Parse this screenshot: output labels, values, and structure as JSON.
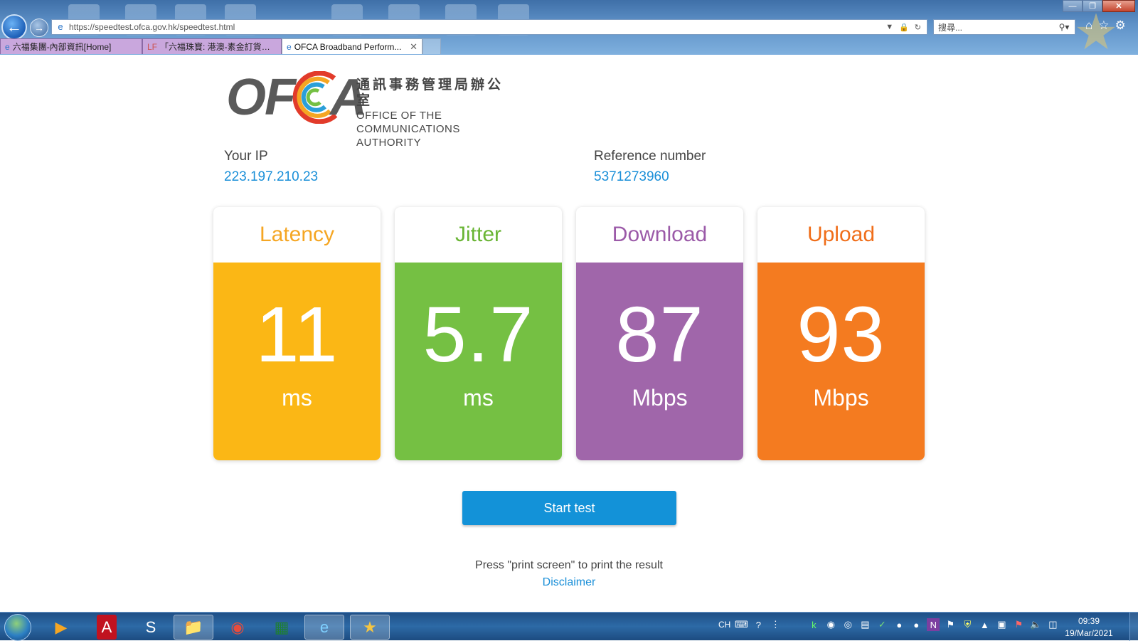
{
  "browser": {
    "url": "https://speedtest.ofca.gov.hk/speedtest.html",
    "search_placeholder": "搜尋...",
    "tabs": [
      {
        "title": "六福集團-內部資訊[Home]"
      },
      {
        "title": "「六福珠寶: 港澳-素金訂貨區..."
      },
      {
        "title": "OFCA Broadband Perform..."
      }
    ]
  },
  "page": {
    "logo": {
      "wordmark": "OFCA",
      "name_zh": "通訊事務管理局辦公室",
      "name_en_line1": "OFFICE OF THE",
      "name_en_line2": "COMMUNICATIONS AUTHORITY"
    },
    "ip": {
      "label": "Your IP",
      "value": "223.197.210.23"
    },
    "reference": {
      "label": "Reference number",
      "value": "5371273960"
    },
    "metrics": [
      {
        "title": "Latency",
        "value": "11",
        "unit": "ms",
        "color": "#FBB715",
        "title_color": "#F5A623"
      },
      {
        "title": "Jitter",
        "value": "5.7",
        "unit": "ms",
        "color": "#75C043",
        "title_color": "#6AB535"
      },
      {
        "title": "Download",
        "value": "87",
        "unit": "Mbps",
        "color": "#A066AA",
        "title_color": "#9B5AA8"
      },
      {
        "title": "Upload",
        "value": "93",
        "unit": "Mbps",
        "color": "#F47B20",
        "title_color": "#F06E1A"
      }
    ],
    "start_button": {
      "label": "Start test",
      "color": "#1392D8"
    },
    "print_note": "Press \"print screen\" to print the result",
    "disclaimer": "Disclaimer"
  },
  "taskbar": {
    "tray_lang": "CH",
    "clock_time": "09:39",
    "clock_date": "19/Mar/2021"
  }
}
